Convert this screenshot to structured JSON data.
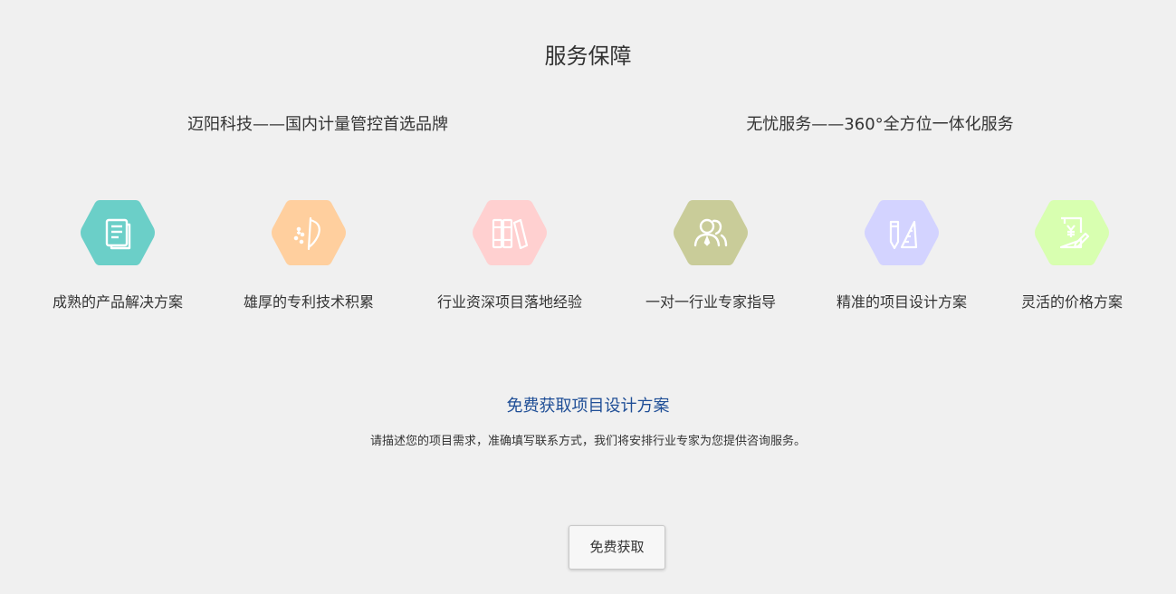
{
  "section": {
    "title": "服务保障",
    "slogan_left": "迈阳科技——国内计量管控首选品牌",
    "slogan_right": "无忧服务——360°全方位一体化服务"
  },
  "features": [
    {
      "label": "成熟的产品解决方案",
      "icon": "document-icon",
      "color": "#6bcfc8"
    },
    {
      "label": "雄厚的专利技术积累",
      "icon": "magic-wand-icon",
      "color": "#ffcf9e"
    },
    {
      "label": "行业资深项目落地经验",
      "icon": "books-icon",
      "color": "#ffd0d0"
    },
    {
      "label": "一对一行业专家指导",
      "icon": "people-icon",
      "color": "#c9cc99"
    },
    {
      "label": "精准的项目设计方案",
      "icon": "pencil-ruler-icon",
      "color": "#d3d3ff"
    },
    {
      "label": "灵活的价格方案",
      "icon": "price-tag-icon",
      "color": "#d8ffb0"
    }
  ],
  "cta": {
    "title": "免费获取项目设计方案",
    "description": "请描述您的项目需求，准确填写联系方式，我们将安排行业专家为您提供咨询服务。",
    "button_label": "免费获取"
  }
}
